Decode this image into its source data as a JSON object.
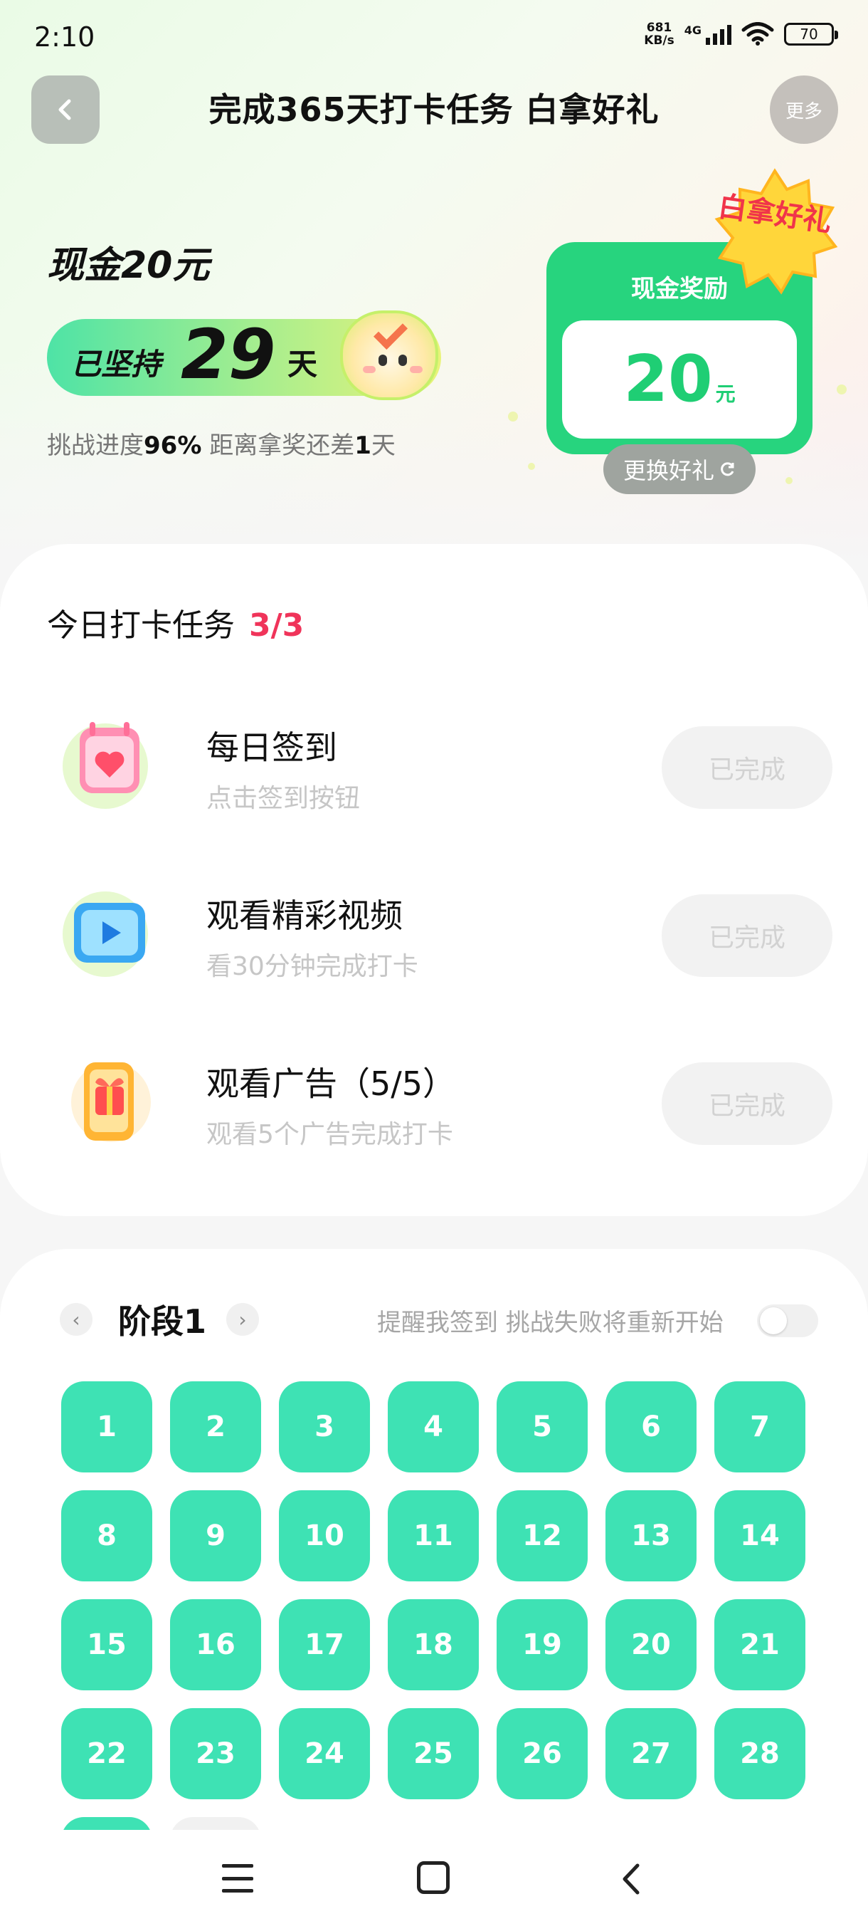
{
  "status_bar": {
    "time": "2:10",
    "net_speed": "681",
    "net_unit": "KB/s",
    "network_type": "4G",
    "battery": "70"
  },
  "header": {
    "title": "完成365天打卡任务 白拿好礼",
    "more_label": "更多"
  },
  "hero": {
    "cash_title": "现金20元",
    "persist_prefix": "已坚持",
    "days": "29",
    "days_suffix": "天",
    "progress_prefix": "挑战进度",
    "progress_value": "96%",
    "progress_mid": " 距离拿奖还差",
    "remaining_days": "1",
    "remaining_suffix": "天"
  },
  "reward": {
    "title": "现金奖励",
    "amount": "20",
    "unit": "元",
    "badge": "白拿好礼",
    "swap_label": "更换好礼"
  },
  "tasks": {
    "header": "今日打卡任务",
    "count": "3/3",
    "items": [
      {
        "title": "每日签到",
        "subtitle": "点击签到按钮",
        "button": "已完成",
        "icon": "calendar-heart-icon"
      },
      {
        "title": "观看精彩视频",
        "subtitle": "看30分钟完成打卡",
        "button": "已完成",
        "icon": "video-play-icon"
      },
      {
        "title": "观看广告（5/5）",
        "subtitle": "观看5个广告完成打卡",
        "button": "已完成",
        "icon": "gift-phone-icon"
      }
    ]
  },
  "calendar": {
    "stage_label": "阶段1",
    "remind_text": "提醒我签到 挑战失败将重新开始",
    "remind_enabled": false,
    "days": [
      "1",
      "2",
      "3",
      "4",
      "5",
      "6",
      "7",
      "8",
      "9",
      "10",
      "11",
      "12",
      "13",
      "14",
      "15",
      "16",
      "17",
      "18",
      "19",
      "20",
      "21",
      "22",
      "23",
      "24",
      "25",
      "26",
      "27",
      "28"
    ]
  },
  "colors": {
    "accent_green": "#27d47e",
    "day_tile": "#3ee2b4",
    "count_red": "#f0345a"
  }
}
